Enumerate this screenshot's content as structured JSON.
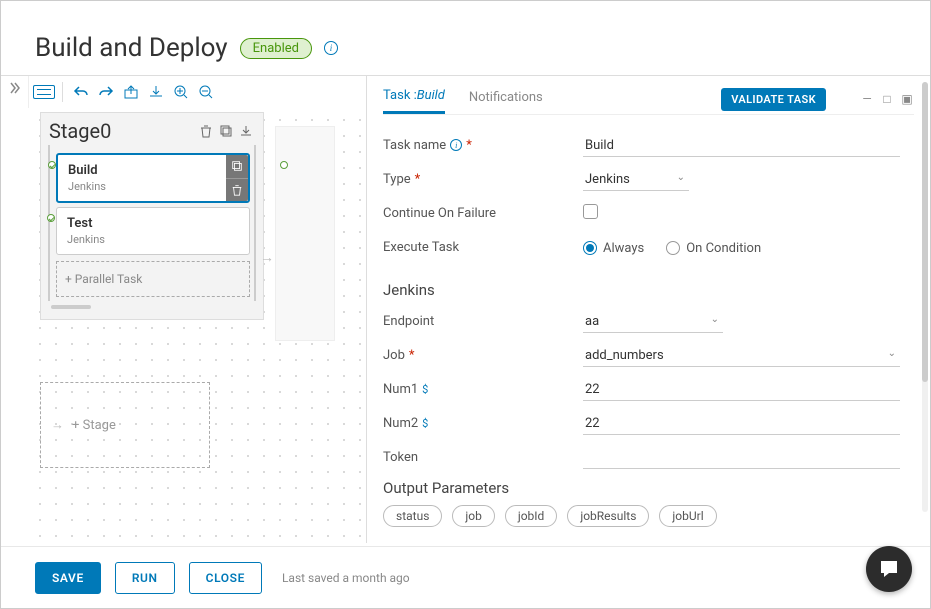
{
  "header": {
    "title": "Build and Deploy",
    "status_badge": "Enabled"
  },
  "canvas": {
    "stage": {
      "name": "Stage0",
      "tasks": [
        {
          "title": "Build",
          "subtitle": "Jenkins",
          "selected": true
        },
        {
          "title": "Test",
          "subtitle": "Jenkins",
          "selected": false
        }
      ],
      "parallel_placeholder": "+ Parallel Task"
    },
    "add_stage_placeholder": "+ Stage"
  },
  "panel": {
    "tabs": {
      "task_prefix": "Task :",
      "task_name": "Build",
      "notifications": "Notifications"
    },
    "validate_button": "VALIDATE TASK",
    "fields": {
      "task_name": {
        "label": "Task name",
        "value": "Build"
      },
      "type": {
        "label": "Type",
        "value": "Jenkins"
      },
      "continue": {
        "label": "Continue On Failure",
        "checked": false
      },
      "execute": {
        "label": "Execute Task",
        "options": [
          "Always",
          "On Condition"
        ],
        "selected": "Always"
      },
      "section": "Jenkins",
      "endpoint": {
        "label": "Endpoint",
        "value": "aa"
      },
      "job": {
        "label": "Job",
        "value": "add_numbers"
      },
      "num1": {
        "label": "Num1",
        "value": "22"
      },
      "num2": {
        "label": "Num2",
        "value": "22"
      },
      "token": {
        "label": "Token",
        "value": ""
      },
      "output_section": "Output Parameters",
      "output_chips": [
        "status",
        "job",
        "jobId",
        "jobResults",
        "jobUrl"
      ]
    }
  },
  "footer": {
    "save": "SAVE",
    "run": "RUN",
    "close": "CLOSE",
    "last_saved": "Last saved a month ago"
  }
}
